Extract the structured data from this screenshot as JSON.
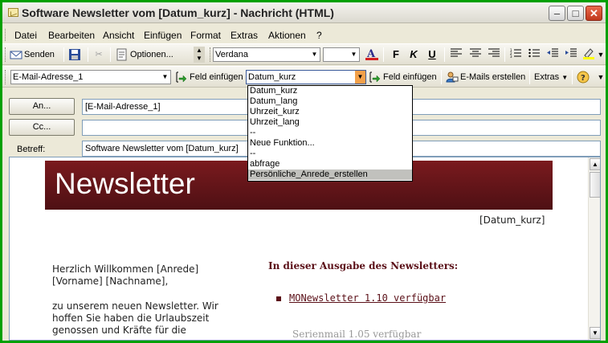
{
  "window": {
    "title": "Software Newsletter vom [Datum_kurz] - Nachricht (HTML)",
    "controls": {
      "minimize": "–",
      "maximize": "□",
      "close": "✕"
    }
  },
  "menu": [
    "Datei",
    "Bearbeiten",
    "Ansicht",
    "Einfügen",
    "Format",
    "Extras",
    "Aktionen",
    "?"
  ],
  "toolbar1": {
    "send": "Senden",
    "options": "Optionen...",
    "font": "Verdana",
    "font_size": ""
  },
  "toolbar2": {
    "field_combo": "E-Mail-Adresse_1",
    "insert_field_1": "Feld einfügen",
    "date_combo": "Datum_kurz",
    "insert_field_2": "Feld einfügen",
    "create_emails": "E-Mails erstellen",
    "extras": "Extras"
  },
  "dropdown": {
    "items": [
      "Datum_kurz",
      "Datum_lang",
      "Uhrzeit_kurz",
      "Uhrzeit_lang",
      "--",
      "Neue Funktion...",
      "--",
      "abfrage",
      "Persönliche_Anrede_erstellen"
    ],
    "selected_index": 8
  },
  "address": {
    "to_button": "An...",
    "to_value": "[E-Mail-Adresse_1]",
    "cc_button": "Cc...",
    "cc_value": "",
    "subject_label": "Betreff:",
    "subject_value": "Software Newsletter vom [Datum_kurz]"
  },
  "newsletter": {
    "banner": "Newsletter",
    "date_placeholder": "[Datum_kurz]",
    "greeting": "Herzlich Willkommen [Anrede] [Vorname] [Nachname],",
    "intro": "zu unserem neuen Newsletter. Wir hoffen Sie haben die Urlaubszeit genossen und Kräfte für die",
    "toc_heading": "In dieser Ausgabe des Newsletters:",
    "toc_item_1": "MONewsletter 1.10 verfügbar",
    "toc_item_2": "Serienmail 1.05 verfügbar"
  },
  "colors": {
    "banner": "#6a1519",
    "accent_text": "#5b1018",
    "window_frame": "#00a000"
  }
}
